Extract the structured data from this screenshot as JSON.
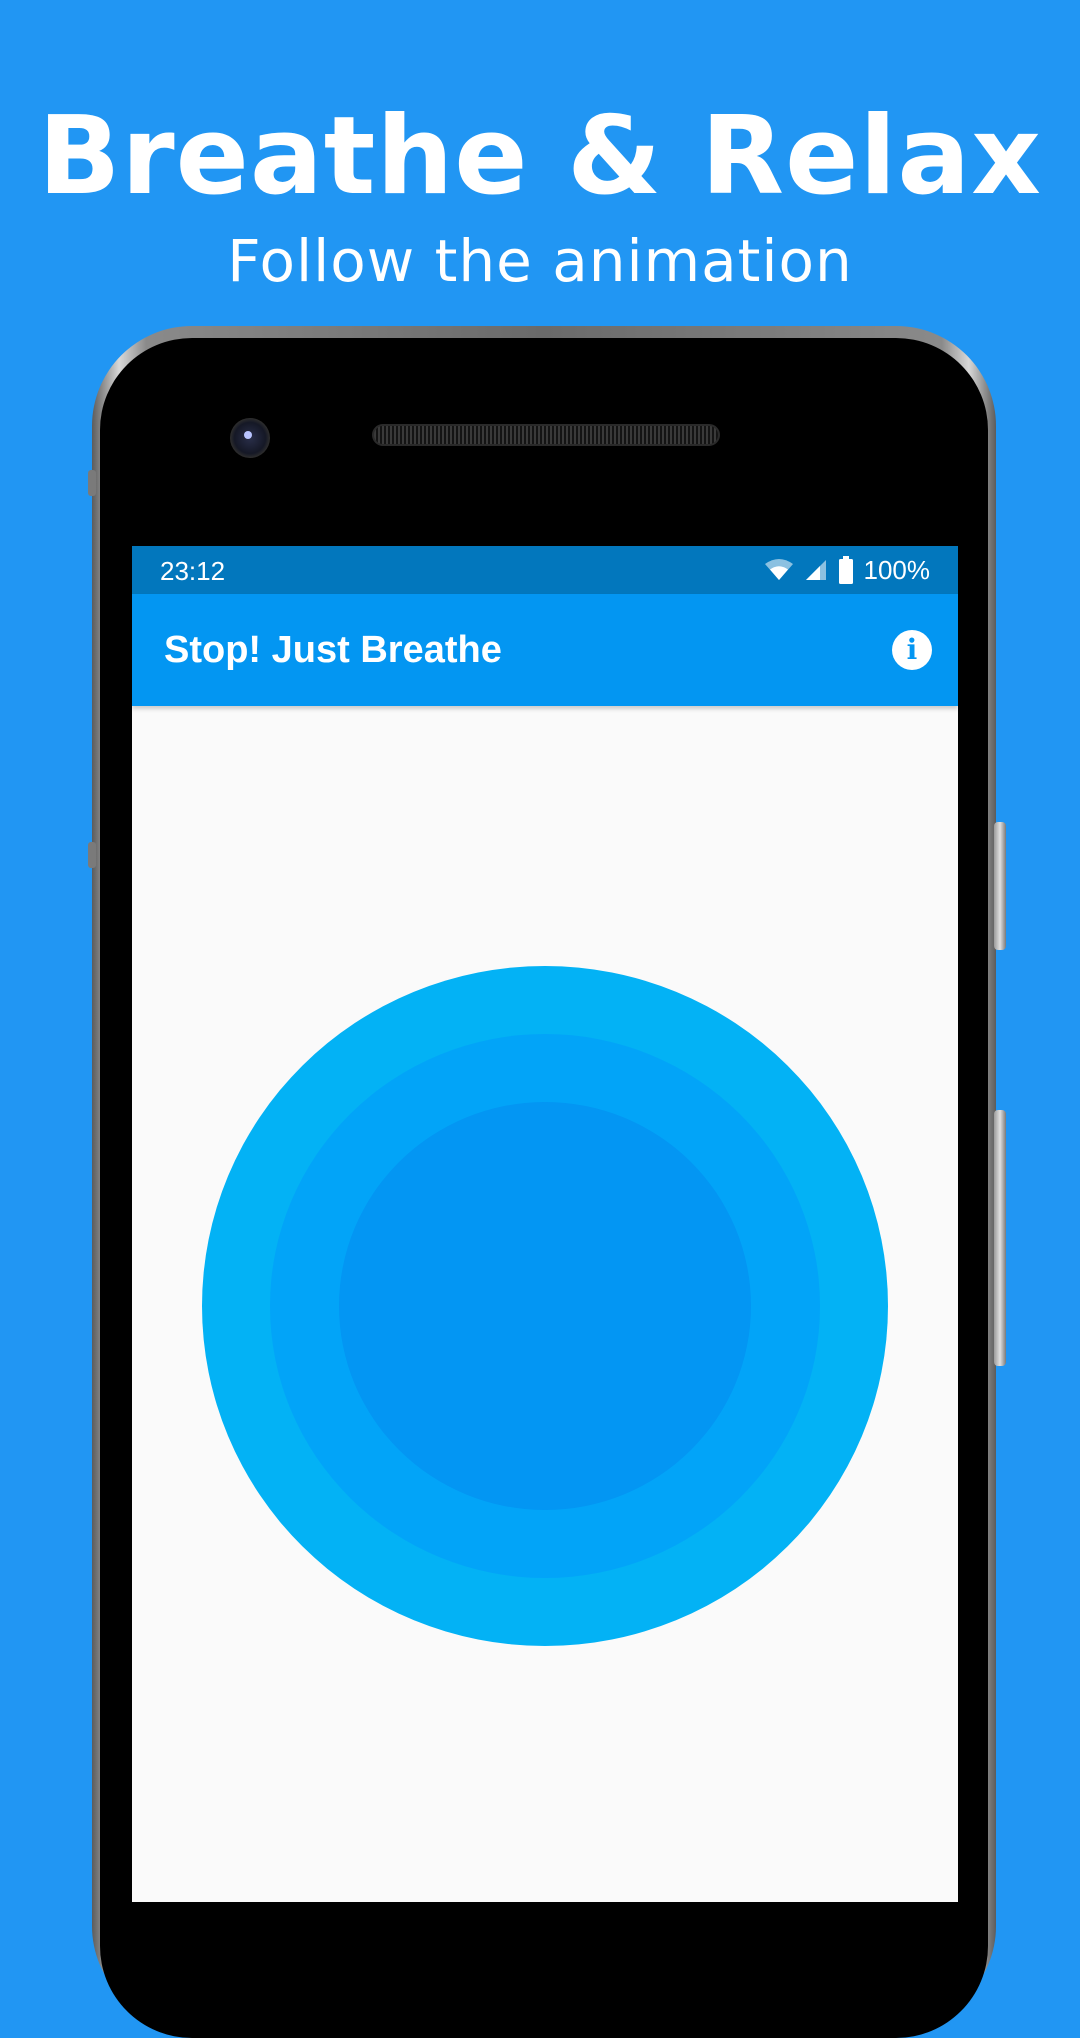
{
  "promo": {
    "headline": "Breathe & Relax",
    "subline": "Follow the animation"
  },
  "status_bar": {
    "time": "23:12",
    "battery": "100%",
    "icons": [
      "wifi-icon",
      "cell-signal-icon",
      "battery-icon"
    ]
  },
  "app_bar": {
    "title": "Stop! Just Breathe",
    "action_icon": "info-icon"
  },
  "colors": {
    "background": "#2196F3",
    "status_bar": "#0277BD",
    "app_bar": "#0396F2",
    "screen": "#FAFAFA",
    "circle_outer": "#03B2F5",
    "circle_middle": "#02A4F8",
    "circle_inner": "#0396F3"
  }
}
